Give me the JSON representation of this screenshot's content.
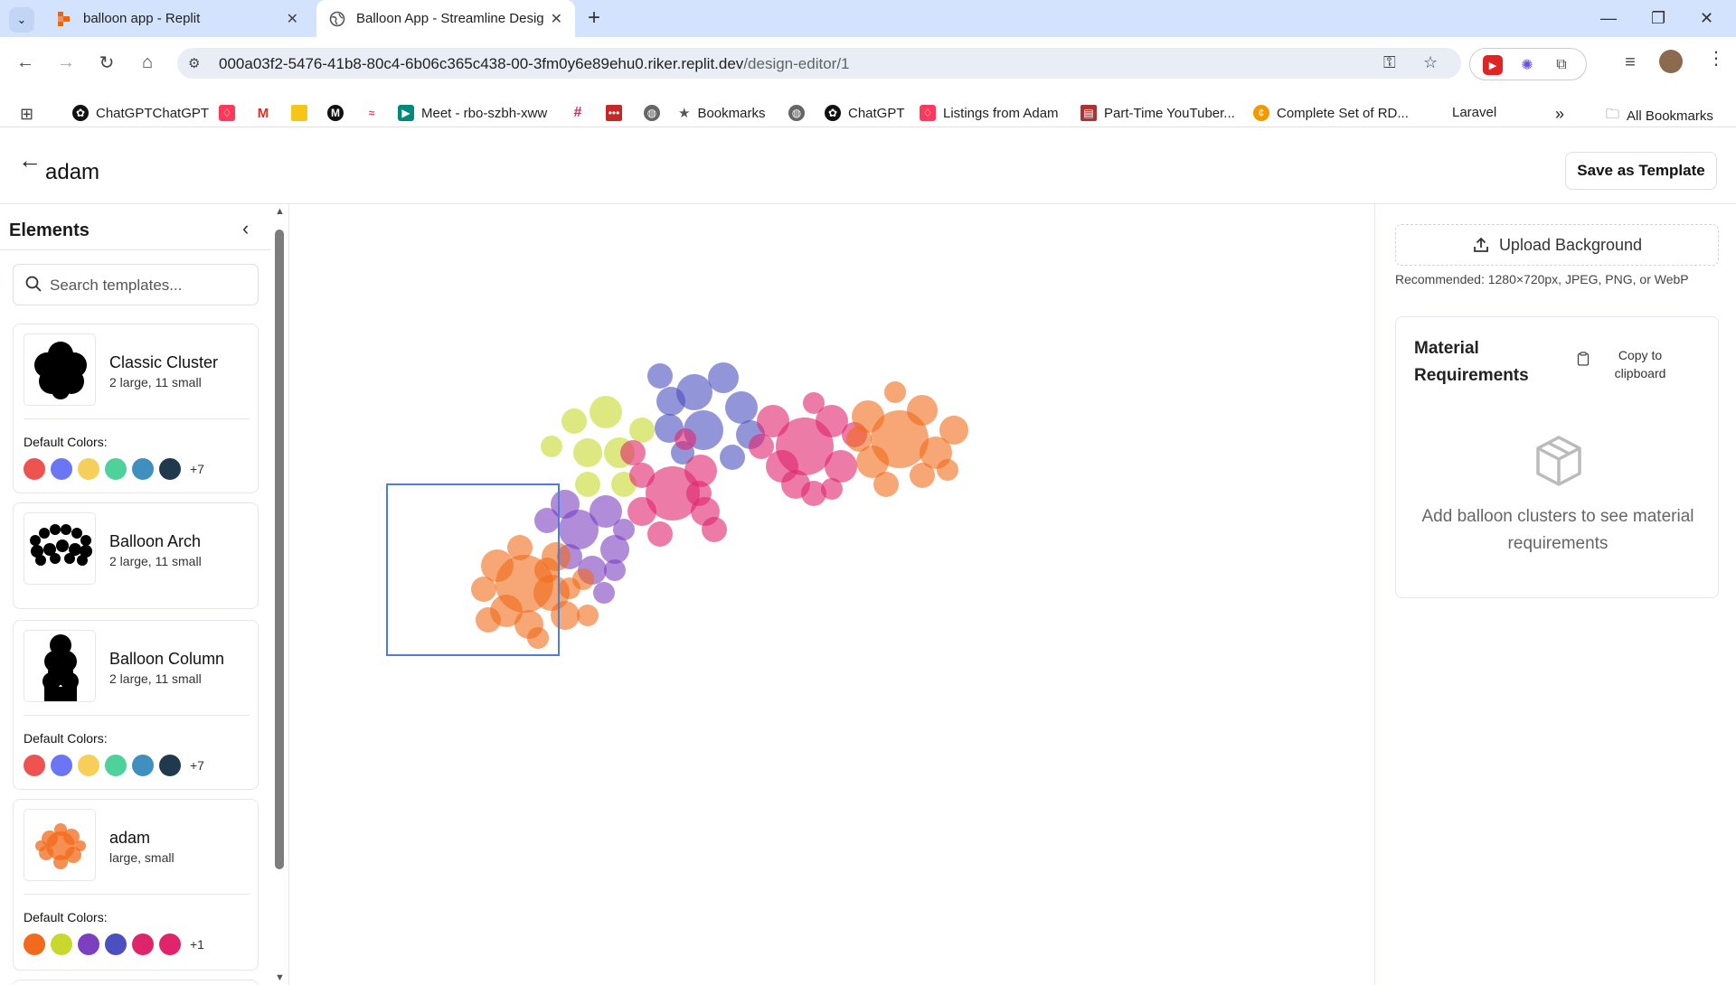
{
  "browser": {
    "tabs": [
      {
        "title": "balloon app - Replit",
        "active": false
      },
      {
        "title": "Balloon App - Streamline Design",
        "active": true
      }
    ],
    "url": {
      "host": "000a03f2-5476-41b8-80c4-6b06c365c438-00-3fm0y6e89ehu0.riker.replit.dev",
      "path": "/design-editor/1"
    },
    "bookmarks": [
      {
        "label": "ChatGPTChatGPT",
        "icon": "openai-icon"
      },
      {
        "label": "",
        "icon": "airbnb-icon"
      },
      {
        "label": "",
        "icon": "gmail-icon"
      },
      {
        "label": "",
        "icon": "sheets-icon"
      },
      {
        "label": "",
        "icon": "m-logo-icon"
      },
      {
        "label": "",
        "icon": "monday-icon"
      },
      {
        "label": "Meet - rbo-szbh-xww",
        "icon": "meet-icon"
      },
      {
        "label": "",
        "icon": "slack-icon"
      },
      {
        "label": "",
        "icon": "dots-icon"
      },
      {
        "label": "",
        "icon": "globe-icon"
      },
      {
        "label": "Bookmarks",
        "icon": "star-icon"
      },
      {
        "label": "",
        "icon": "globe-icon"
      },
      {
        "label": "ChatGPT",
        "icon": "openai-icon"
      },
      {
        "label": "Listings from Adam",
        "icon": "airbnb-icon"
      },
      {
        "label": "Part-Time YouTuber...",
        "icon": "clapper-icon"
      },
      {
        "label": "Complete Set of RD...",
        "icon": "coin-icon"
      },
      {
        "label": "Laravel",
        "icon": ""
      }
    ],
    "all_bookmarks": "All Bookmarks"
  },
  "header": {
    "title": "adam",
    "save_template": "Save as Template"
  },
  "sidebar": {
    "title": "Elements",
    "search_placeholder": "Search templates...",
    "templates": [
      {
        "name": "Classic Cluster",
        "desc": "2 large, 11 small",
        "colors_label": "Default Colors:",
        "colors": [
          "#ef5350",
          "#6b76f6",
          "#f6cf5b",
          "#4fd19c",
          "#3f8fbf",
          "#1e3a4c"
        ],
        "more": "+7"
      },
      {
        "name": "Balloon Arch",
        "desc": "2 large, 11 small"
      },
      {
        "name": "Balloon Column",
        "desc": "2 large, 11 small",
        "colors_label": "Default Colors:",
        "colors": [
          "#ef5350",
          "#6b76f6",
          "#f6cf5b",
          "#4fd19c",
          "#3f8fbf",
          "#1e3a4c"
        ],
        "more": "+7"
      },
      {
        "name": "adam",
        "desc": "large, small",
        "colors_label": "Default Colors:",
        "colors": [
          "#f26a1b",
          "#c8d82d",
          "#7b3fbf",
          "#4b4fbf",
          "#e0246c",
          "#e0246c"
        ],
        "more": "+1"
      }
    ]
  },
  "right_panel": {
    "upload_label": "Upload Background",
    "recommended": "Recommended: 1280×720px, JPEG, PNG, or WebP",
    "material_title": "Material Requirements",
    "copy_label": "Copy to clipboard",
    "empty_message": "Add balloon clusters to see material requirements"
  },
  "colors": {
    "orange": "#f26a1b",
    "lime": "#c8d82d",
    "purple": "#7b3fbf",
    "indigo": "#4b4fbf",
    "pink": "#e0246c",
    "selection": "#4a7fd8"
  }
}
